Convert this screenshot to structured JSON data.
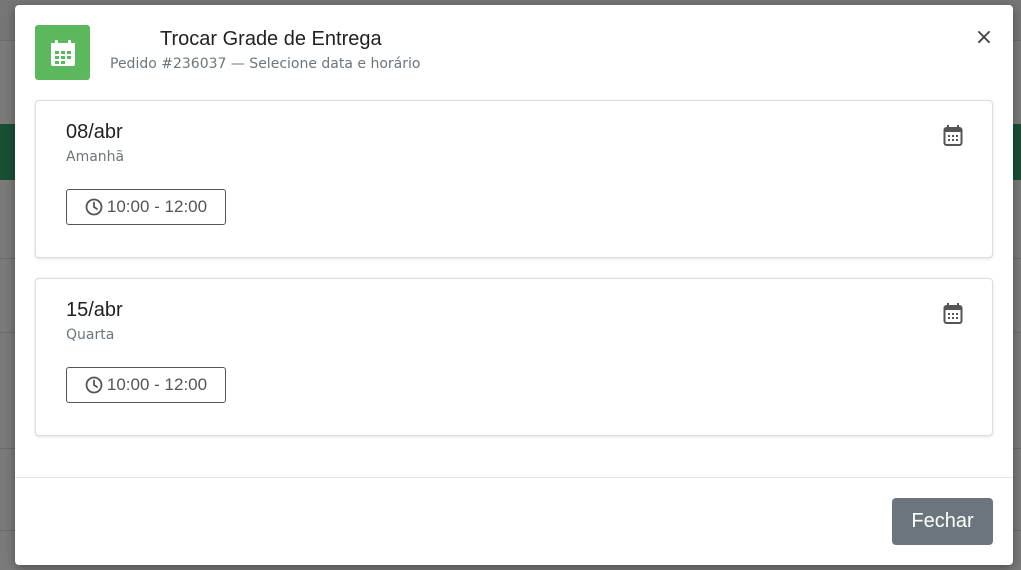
{
  "modal": {
    "title": "Trocar Grade de Entrega",
    "subtitle": "Pedido #236037 — Selecione data e horário",
    "close_symbol": "×",
    "header_icon": "calendar-icon",
    "accent_color": "#5cb85c"
  },
  "dates": [
    {
      "date": "08/abr",
      "day": "Amanhã",
      "slot": "10:00 - 12:00",
      "icon": "calendar-icon"
    },
    {
      "date": "15/abr",
      "day": "Quarta",
      "slot": "10:00 - 12:00",
      "icon": "calendar-icon"
    }
  ],
  "footer": {
    "close_label": "Fechar",
    "button_color": "#6c757d"
  }
}
